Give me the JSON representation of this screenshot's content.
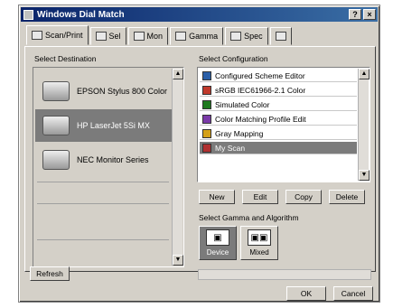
{
  "window": {
    "title": "Windows Dial Match"
  },
  "tabs": [
    {
      "label": "Scan/Print",
      "icon": "scanner-icon"
    },
    {
      "label": "Sel",
      "icon": "grid-icon"
    },
    {
      "label": "Mon",
      "icon": "monitor-icon"
    },
    {
      "label": "Gamma",
      "icon": "gamma-icon"
    },
    {
      "label": "Spec",
      "icon": "spec-icon"
    },
    {
      "label": "",
      "icon": "folder-icon"
    }
  ],
  "devices": {
    "label": "Select Destination",
    "items": [
      {
        "name": "EPSON Stylus 800 Color",
        "selected": false
      },
      {
        "name": "HP LaserJet 5Si MX",
        "selected": true
      },
      {
        "name": "NEC Monitor Series",
        "selected": false
      }
    ],
    "refresh_label": "Refresh"
  },
  "configurations": {
    "label": "Select Configuration",
    "items": [
      {
        "name": "Configured Scheme Editor",
        "color": "#2a5fa8",
        "selected": false
      },
      {
        "name": "sRGB IEC61966-2.1 Color",
        "color": "#c0392b",
        "selected": false
      },
      {
        "name": "Simulated Color",
        "color": "#1f7a1f",
        "selected": false
      },
      {
        "name": "Color Matching Profile Edit",
        "color": "#7a3aa8",
        "selected": false
      },
      {
        "name": "Gray Mapping",
        "color": "#d4a017",
        "selected": false
      },
      {
        "name": "My Scan",
        "color": "#b03030",
        "selected": true
      }
    ],
    "buttons": [
      "New",
      "Edit",
      "Copy",
      "Delete"
    ]
  },
  "gamma": {
    "label": "Select Gamma and Algorithm",
    "options": [
      {
        "label": "Device",
        "active": true
      },
      {
        "label": "Mixed",
        "active": false
      }
    ]
  },
  "footer": {
    "ok_label": "OK",
    "cancel_label": "Cancel"
  }
}
